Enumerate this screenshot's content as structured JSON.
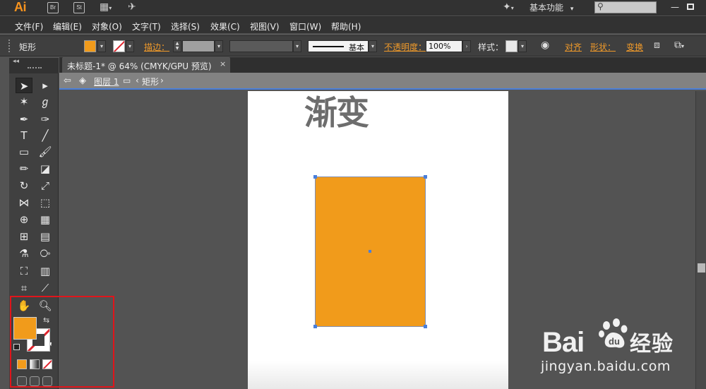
{
  "app": {
    "logo": "Ai",
    "br_chip": "Br",
    "st_chip": "St"
  },
  "workspace": {
    "label": "基本功能",
    "arrow": "▾"
  },
  "window_controls": {
    "minimize": "—",
    "restore": "▫"
  },
  "menu": {
    "items": [
      "文件(F)",
      "编辑(E)",
      "对象(O)",
      "文字(T)",
      "选择(S)",
      "效果(C)",
      "视图(V)",
      "窗口(W)",
      "帮助(H)"
    ]
  },
  "control": {
    "object_type": "矩形",
    "stroke_link": "描边：",
    "stroke_profile": "基本",
    "opacity_link": "不透明度：",
    "opacity_value": "100%",
    "style_label": "样式：",
    "align_link": "对齐",
    "shape_link": "形状：",
    "transform_link": "变换",
    "fill_color": "#f19b1b"
  },
  "document": {
    "tab_title": "未标题-1* @ 64% (CMYK/GPU 预览)",
    "close": "×"
  },
  "breadcrumb": {
    "layer": "图层 1",
    "object": "矩形"
  },
  "artwork": {
    "title": "渐变",
    "rect_fill": "#f19b1b"
  },
  "watermark": {
    "brand": "Bai",
    "brand2": "经验",
    "url": "jingyan.baidu.com"
  }
}
